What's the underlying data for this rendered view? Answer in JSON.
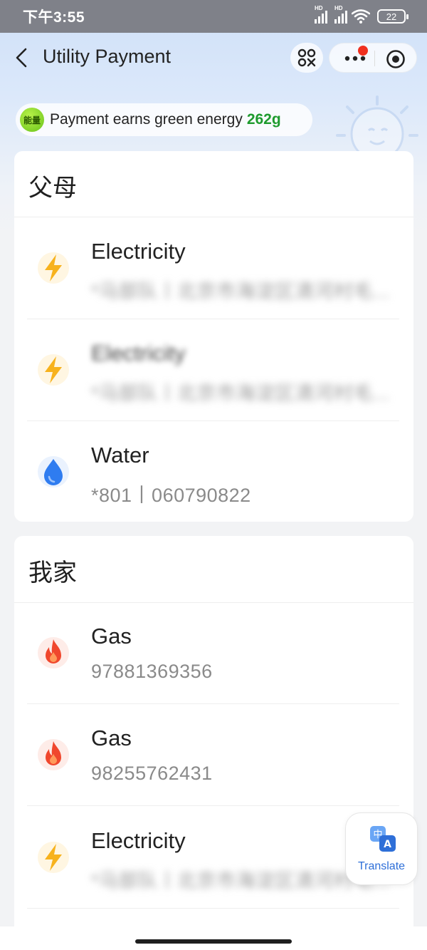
{
  "status_bar": {
    "time": "下午3:55",
    "signal_1_tag": "HD",
    "signal_2_tag": "HD",
    "battery": "22"
  },
  "header": {
    "title": "Utility Payment",
    "back_icon": "chevron-left-icon",
    "scan_icon": "scan-code-icon",
    "more_icon": "more-dots-icon",
    "close_icon": "target-circle-icon"
  },
  "energy_banner": {
    "badge": "能量",
    "text": "Payment earns green energy",
    "amount": "262g"
  },
  "groups": [
    {
      "title": "父母",
      "items": [
        {
          "type": "Electricity",
          "icon": "lightning-icon",
          "detail": "*马部队丨北京市海淀区清河村毛...",
          "blurred": true
        },
        {
          "type": "Electricity",
          "icon": "lightning-icon",
          "detail": "*马部队丨北京市海淀区清河村毛...",
          "blurred": true
        },
        {
          "type": "Water",
          "icon": "water-drop-icon",
          "detail": "*801丨060790822",
          "blurred": false
        }
      ]
    },
    {
      "title": "我家",
      "items": [
        {
          "type": "Gas",
          "icon": "flame-icon",
          "detail": "97881369356",
          "blurred": false
        },
        {
          "type": "Gas",
          "icon": "flame-icon",
          "detail": "98255762431",
          "blurred": false
        },
        {
          "type": "Electricity",
          "icon": "lightning-icon",
          "detail": "*马部队丨北京市海淀区清河村毛...",
          "blurred": true
        }
      ]
    }
  ],
  "translate": {
    "label": "Translate",
    "icon": "translate-icon"
  },
  "colors": {
    "accent_green": "#1e9b2e",
    "electricity": "#f7b21d",
    "water": "#2f7cf0",
    "gas": "#f0472d",
    "translate_blue": "#2e6fd8"
  }
}
